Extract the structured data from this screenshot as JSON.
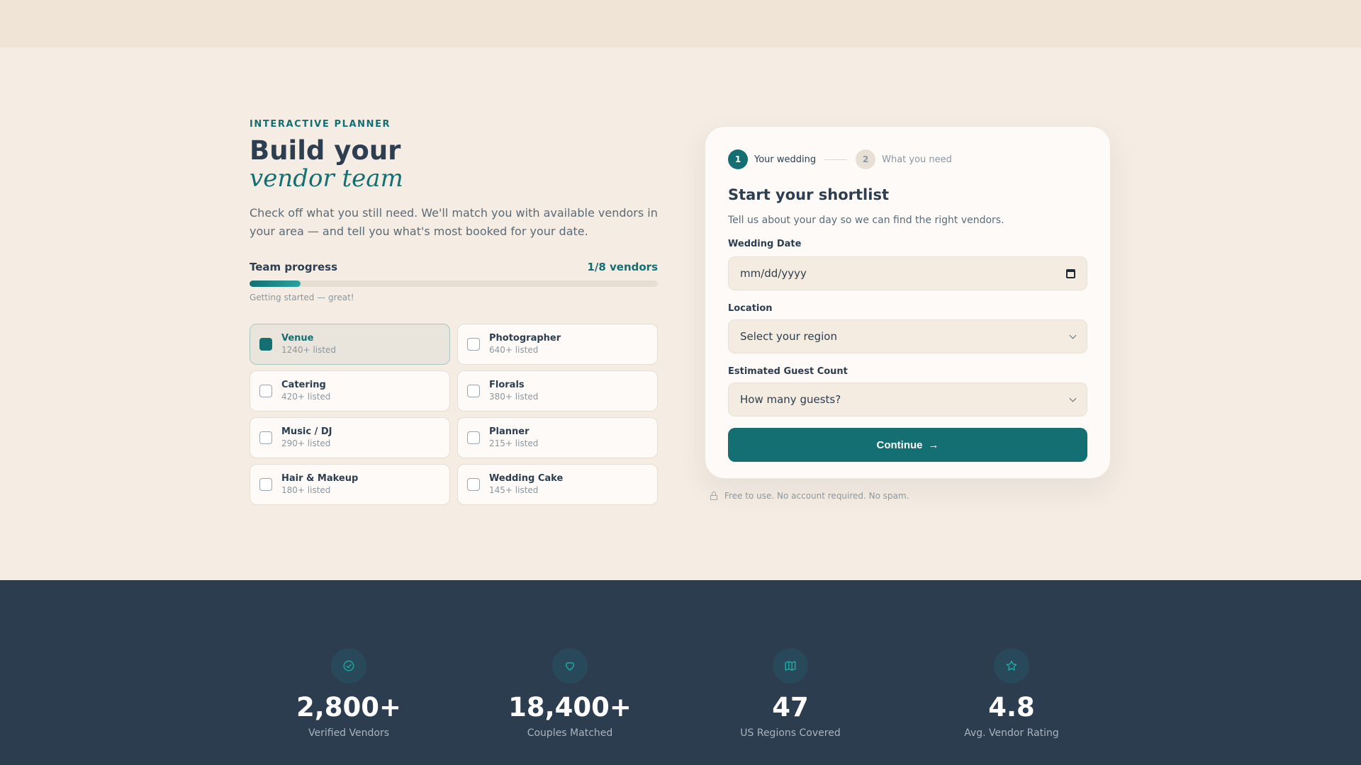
{
  "hero": {
    "eyebrow": "INTERACTIVE PLANNER",
    "headline": "Build your",
    "headline_italic": "vendor team",
    "lede": "Check off what you still need. We'll match you with available vendors in your area — and tell you what's most booked for your date."
  },
  "progress": {
    "title": "Team progress",
    "count_label": "1/8 vendors",
    "fraction": 0.125,
    "note": "Getting started — great!"
  },
  "vendors": [
    {
      "name": "Venue",
      "listed": "1240+ listed",
      "checked": true
    },
    {
      "name": "Photographer",
      "listed": "640+ listed",
      "checked": false
    },
    {
      "name": "Catering",
      "listed": "420+ listed",
      "checked": false
    },
    {
      "name": "Florals",
      "listed": "380+ listed",
      "checked": false
    },
    {
      "name": "Music / DJ",
      "listed": "290+ listed",
      "checked": false
    },
    {
      "name": "Planner",
      "listed": "215+ listed",
      "checked": false
    },
    {
      "name": "Hair & Makeup",
      "listed": "180+ listed",
      "checked": false
    },
    {
      "name": "Wedding Cake",
      "listed": "145+ listed",
      "checked": false
    }
  ],
  "form": {
    "steps": [
      {
        "number": "1",
        "label": "Your wedding"
      },
      {
        "number": "2",
        "label": "What you need"
      }
    ],
    "title": "Start your shortlist",
    "subtitle": "Tell us about your day so we can find the right vendors.",
    "date_label": "Wedding Date",
    "date_placeholder": "mm/dd/yyyy",
    "location_label": "Location",
    "location_value": "Select your region",
    "guests_label": "Estimated Guest Count",
    "guests_value": "How many guests?",
    "continue_label": "Continue",
    "arrow": "→",
    "footnote": "Free to use. No account required. No spam."
  },
  "stats": [
    {
      "icon": "check-circle-icon",
      "value": "2,800+",
      "label": "Verified Vendors"
    },
    {
      "icon": "heart-icon",
      "value": "18,400+",
      "label": "Couples Matched"
    },
    {
      "icon": "map-icon",
      "value": "47",
      "label": "US Regions Covered"
    },
    {
      "icon": "star-icon",
      "value": "4.8",
      "label": "Avg. Vendor Rating"
    }
  ],
  "colors": {
    "accent": "#136f72",
    "background": "#f5ece3",
    "dark": "#2c3d50"
  }
}
